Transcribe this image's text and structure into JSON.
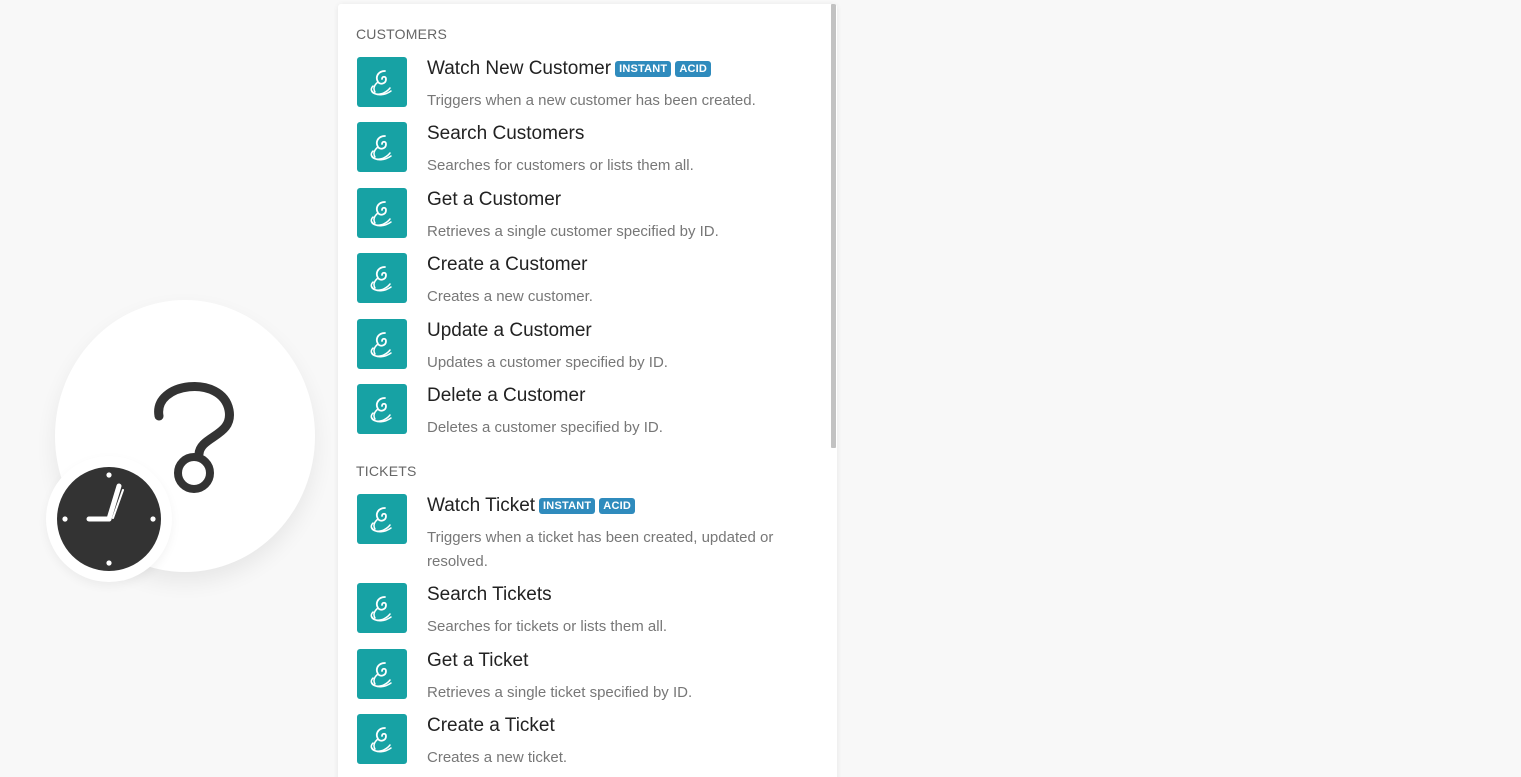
{
  "colors": {
    "app_accent": "#17a2a4",
    "badge": "#2f8bbd",
    "background": "#f8f8f8"
  },
  "module": {
    "icon": "question-mark-icon",
    "badge_icon": "clock-icon"
  },
  "sections": [
    {
      "header": "CUSTOMERS",
      "items": [
        {
          "title": "Watch New Customer",
          "badges": [
            "INSTANT",
            "ACID"
          ],
          "description": "Triggers when a new customer has been created."
        },
        {
          "title": "Search Customers",
          "badges": [],
          "description": "Searches for customers or lists them all."
        },
        {
          "title": "Get a Customer",
          "badges": [],
          "description": "Retrieves a single customer specified by ID."
        },
        {
          "title": "Create a Customer",
          "badges": [],
          "description": "Creates a new customer."
        },
        {
          "title": "Update a Customer",
          "badges": [],
          "description": "Updates a customer specified by ID."
        },
        {
          "title": "Delete a Customer",
          "badges": [],
          "description": "Deletes a customer specified by ID."
        }
      ]
    },
    {
      "header": "TICKETS",
      "items": [
        {
          "title": "Watch Ticket",
          "badges": [
            "INSTANT",
            "ACID"
          ],
          "description": "Triggers when a ticket has been created, updated or resolved."
        },
        {
          "title": "Search Tickets",
          "badges": [],
          "description": "Searches for tickets or lists them all."
        },
        {
          "title": "Get a Ticket",
          "badges": [],
          "description": "Retrieves a single ticket specified by ID."
        },
        {
          "title": "Create a Ticket",
          "badges": [],
          "description": "Creates a new ticket."
        }
      ]
    }
  ]
}
